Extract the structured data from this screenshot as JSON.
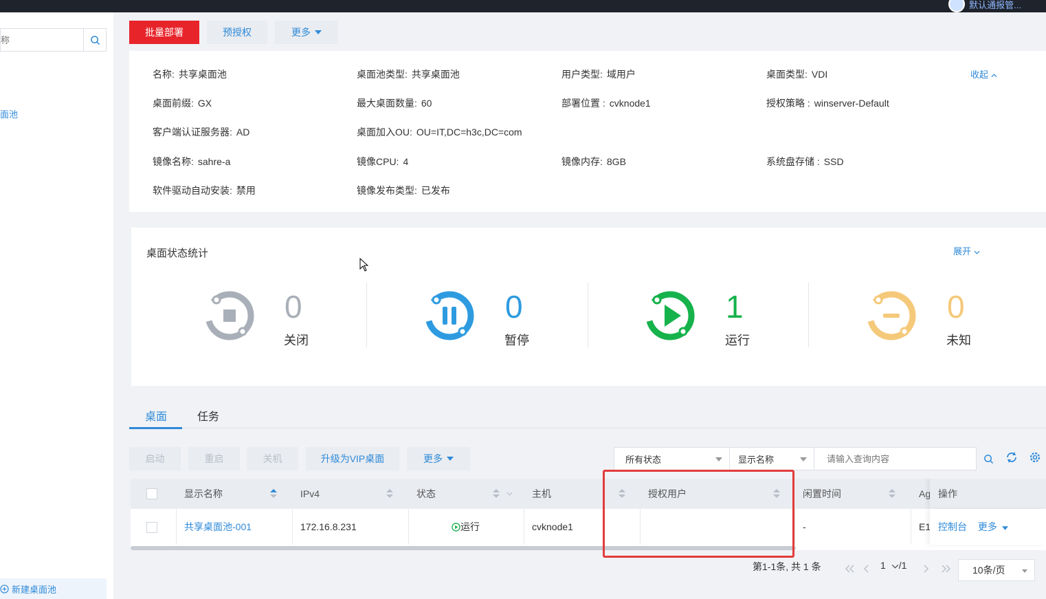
{
  "topbar": {
    "user_text": "默认通报管..."
  },
  "sidebar": {
    "search_placeholder": "称",
    "item_label": "面池",
    "new_pool_label": "新建桌面池"
  },
  "toolbar": {
    "batch_deploy": "批量部署",
    "pre_authorize": "预授权",
    "more": "更多"
  },
  "info": {
    "collapse": "收起",
    "items": [
      {
        "k": "名称:",
        "v": "共享桌面池"
      },
      {
        "k": "桌面池类型:",
        "v": "共享桌面池"
      },
      {
        "k": "用户类型:",
        "v": "域用户"
      },
      {
        "k": "桌面类型:",
        "v": "VDI"
      },
      {
        "k": "桌面前缀:",
        "v": "GX"
      },
      {
        "k": "最大桌面数量:",
        "v": "60"
      },
      {
        "k": "部署位置 :",
        "v": "cvknode1"
      },
      {
        "k": "授权策略 :",
        "v": "winserver-Default"
      },
      {
        "k": "客户端认证服务器:",
        "v": "AD"
      },
      {
        "k": "桌面加入OU:",
        "v": "OU=IT,DC=h3c,DC=com"
      },
      {
        "k": "镜像名称:",
        "v": "sahre-a"
      },
      {
        "k": "镜像CPU:",
        "v": "4"
      },
      {
        "k": "镜像内存:",
        "v": "8GB"
      },
      {
        "k": "系统盘存储 :",
        "v": "SSD"
      },
      {
        "k": "软件驱动自动安装:",
        "v": "禁用"
      },
      {
        "k": "镜像发布类型:",
        "v": "已发布"
      }
    ]
  },
  "stats": {
    "title": "桌面状态统计",
    "expand": "展开",
    "items": [
      {
        "count": "0",
        "label": "关闭",
        "color": "#a9afb8"
      },
      {
        "count": "0",
        "label": "暂停",
        "color": "#2e9be0"
      },
      {
        "count": "1",
        "label": "运行",
        "color": "#16b24b"
      },
      {
        "count": "0",
        "label": "未知",
        "color": "#f5c97a"
      }
    ]
  },
  "tabs": {
    "desktop": "桌面",
    "task": "任务"
  },
  "actions": {
    "start": "启动",
    "restart": "重启",
    "shutdown": "关机",
    "upgrade_vip": "升级为VIP桌面",
    "more": "更多"
  },
  "filters": {
    "status": "所有状态",
    "field": "显示名称",
    "query_placeholder": "请输入查询内容"
  },
  "table": {
    "headers": {
      "display_name": "显示名称",
      "ipv4": "IPv4",
      "status": "状态",
      "host": "主机",
      "auth_user": "授权用户",
      "idle_time": "闲置时间",
      "agent": "Ag",
      "ops": "操作"
    },
    "row": {
      "display_name": "共享桌面池-001",
      "ipv4": "172.16.8.231",
      "status": "运行",
      "host": "cvknode1",
      "auth_user": "",
      "idle_time": "-",
      "agent": "E1",
      "console": "控制台",
      "more": "更多"
    }
  },
  "pager": {
    "summary": "第1-1条, 共 1 条",
    "page": "1",
    "total": "/1",
    "page_size": "10条/页"
  }
}
